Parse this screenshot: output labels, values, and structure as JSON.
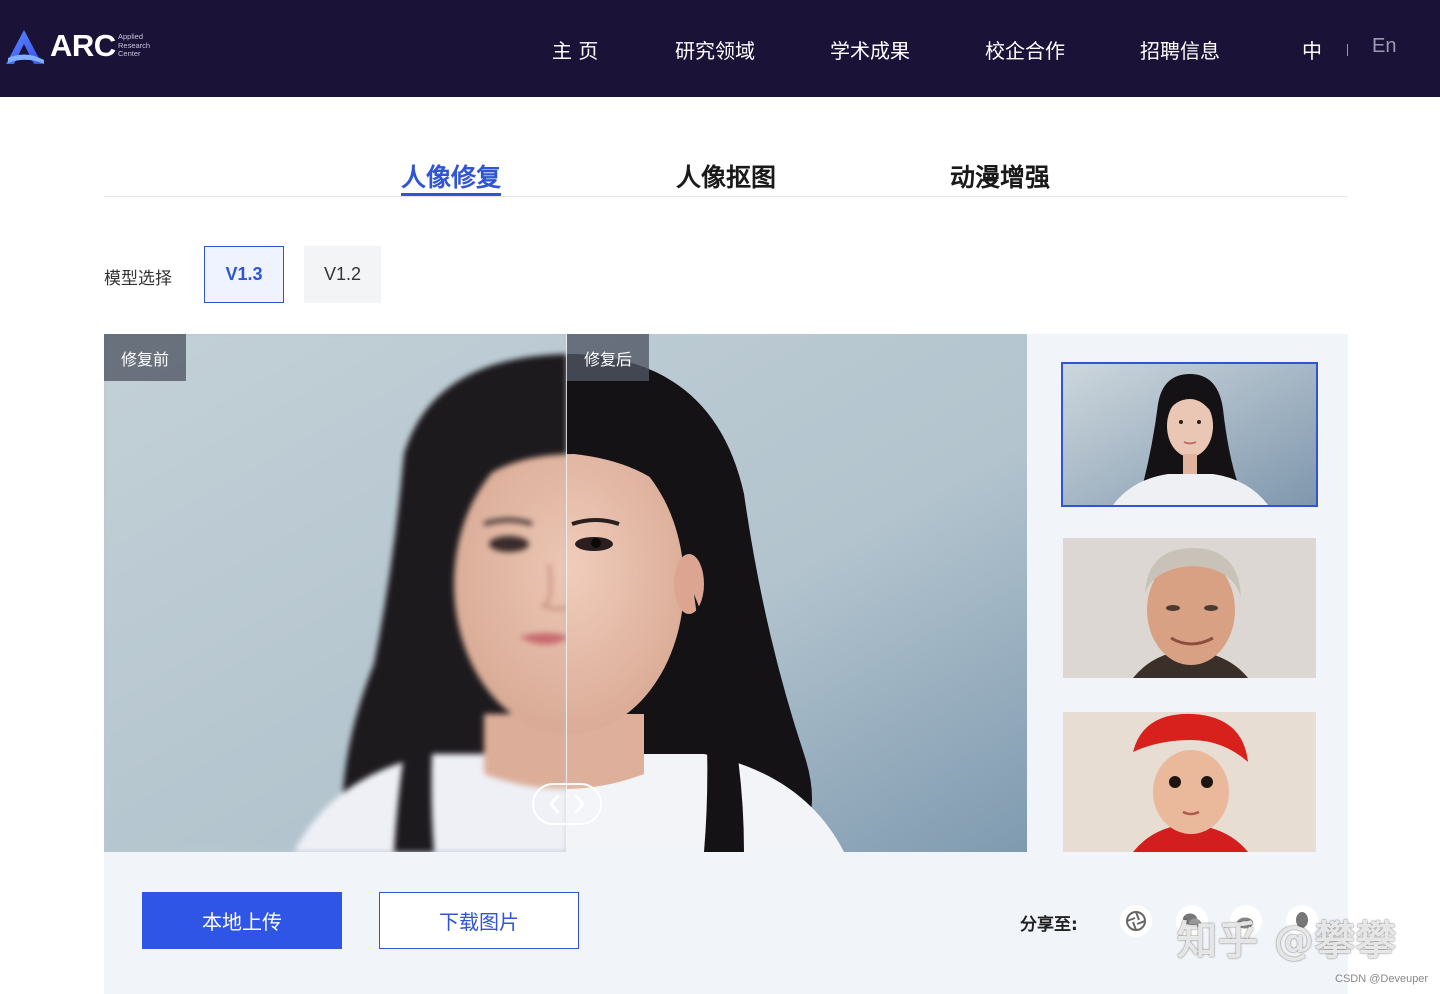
{
  "header": {
    "logo_text": "ARC",
    "logo_subtitle_lines": [
      "Applied",
      "Research",
      "Center"
    ],
    "nav": [
      "主 页",
      "研究领域",
      "学术成果",
      "校企合作",
      "招聘信息"
    ],
    "lang_zh": "中",
    "lang_en": "En"
  },
  "tabs": [
    "人像修复",
    "人像抠图",
    "动漫增强"
  ],
  "active_tab": "人像修复",
  "model": {
    "label": "模型选择",
    "options": [
      "V1.3",
      "V1.2"
    ],
    "selected": "V1.3"
  },
  "compare": {
    "before_label": "修复前",
    "after_label": "修复后"
  },
  "thumbnails": [
    {
      "name": "young-woman-thumbnail",
      "selected": true
    },
    {
      "name": "older-man-thumbnail",
      "selected": false
    },
    {
      "name": "baby-red-hat-thumbnail",
      "selected": false
    }
  ],
  "actions": {
    "upload_label": "本地上传",
    "download_label": "下载图片",
    "share_label": "分享至:"
  },
  "share_icons": [
    "camera-shutter-icon",
    "wechat-icon",
    "weibo-icon",
    "qq-icon"
  ],
  "watermark": "知乎 @攀攀",
  "credit": "CSDN @Deveuper",
  "colors": {
    "header_bg": "#1b1238",
    "accent": "#2f55d4",
    "upload_button": "#2f55e6",
    "panel_bg": "#f1f4f8"
  }
}
